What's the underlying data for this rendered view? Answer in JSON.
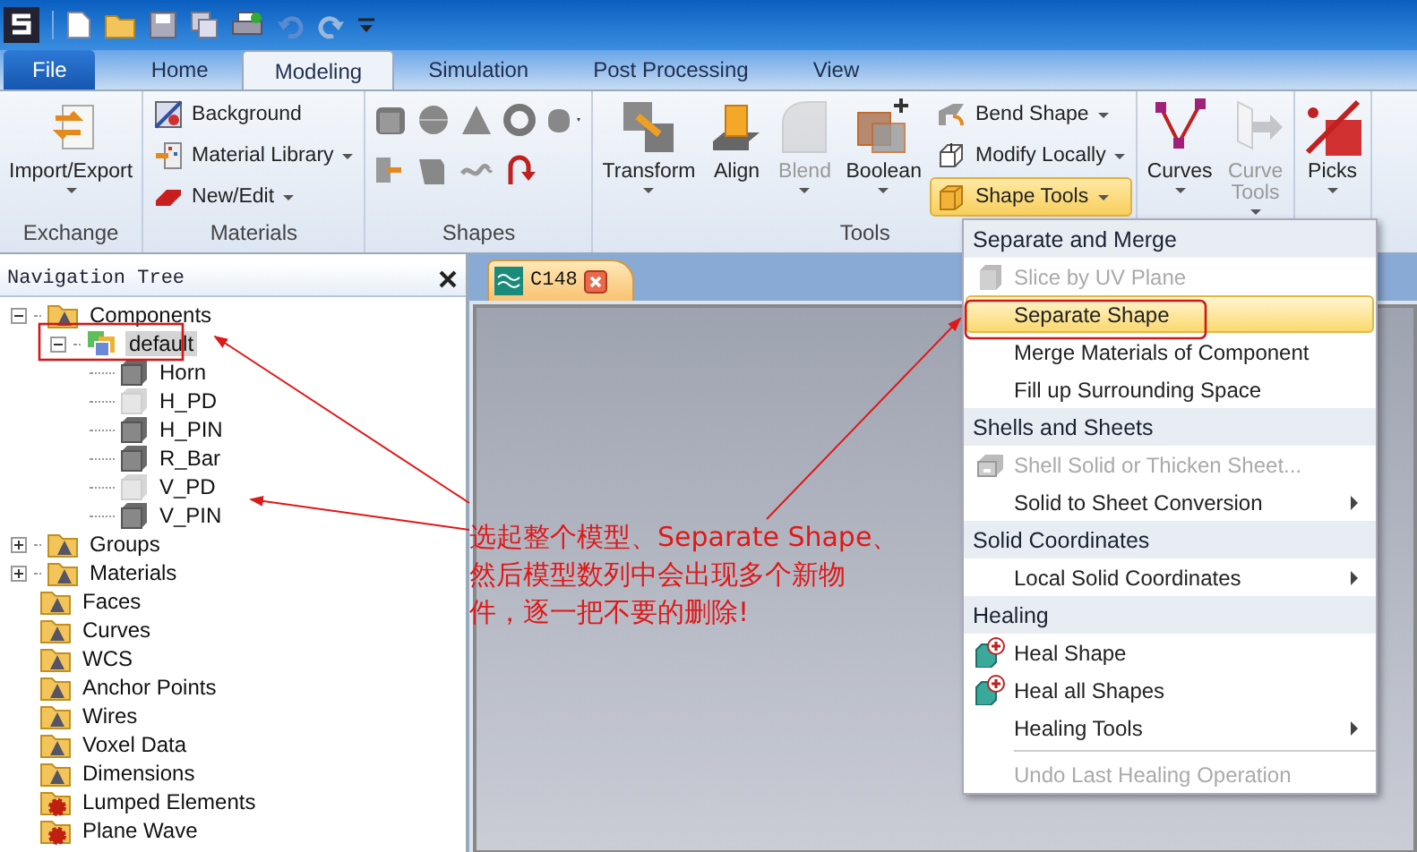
{
  "ribbon_tabs": [
    {
      "label": "File",
      "kind": "file",
      "selected": false
    },
    {
      "label": "Home",
      "kind": "tab",
      "selected": false
    },
    {
      "label": "Modeling",
      "kind": "tab",
      "selected": true
    },
    {
      "label": "Simulation",
      "kind": "tab",
      "selected": false
    },
    {
      "label": "Post Processing",
      "kind": "tab",
      "selected": false
    },
    {
      "label": "View",
      "kind": "tab",
      "selected": false
    }
  ],
  "ribbon_groups": [
    {
      "label": "Exchange",
      "kind": "buttons",
      "items": [
        {
          "label": "Import/Export",
          "kind": "large",
          "dropdown": true,
          "disabled": false,
          "selected": false
        }
      ]
    },
    {
      "label": "Materials",
      "kind": "buttons",
      "items": [
        {
          "label": "Background",
          "kind": "small",
          "dropdown": false,
          "disabled": false,
          "selected": false
        },
        {
          "label": "Material Library",
          "kind": "small",
          "dropdown": true,
          "disabled": false,
          "selected": false
        },
        {
          "label": "New/Edit",
          "kind": "small",
          "dropdown": true,
          "disabled": false,
          "selected": false
        }
      ]
    },
    {
      "label": "Shapes",
      "kind": "shapes"
    },
    {
      "label": "Tools",
      "kind": "buttons",
      "items": [
        {
          "label": "Transform",
          "kind": "large",
          "dropdown": true,
          "disabled": false,
          "selected": false
        },
        {
          "label": "Align",
          "kind": "large",
          "dropdown": false,
          "disabled": false,
          "selected": false
        },
        {
          "label": "Blend",
          "kind": "large",
          "dropdown": true,
          "disabled": true,
          "selected": false
        },
        {
          "label": "Boolean",
          "kind": "large",
          "dropdown": true,
          "disabled": false,
          "selected": false
        },
        {
          "label": "Bend Shape",
          "kind": "small",
          "dropdown": true,
          "disabled": false,
          "selected": false
        },
        {
          "label": "Modify Locally",
          "kind": "small",
          "dropdown": true,
          "disabled": false,
          "selected": false
        },
        {
          "label": "Shape Tools",
          "kind": "small",
          "dropdown": true,
          "disabled": false,
          "selected": true
        }
      ]
    },
    {
      "kind": "buttons",
      "items": [
        {
          "label": "Curves",
          "kind": "large",
          "dropdown": true,
          "disabled": false,
          "selected": false
        },
        {
          "label": "Curve Tools",
          "kind": "large",
          "dropdown": true,
          "disabled": true,
          "selected": false
        }
      ]
    },
    {
      "kind": "buttons",
      "items": [
        {
          "label": "Picks",
          "kind": "large",
          "dropdown": true,
          "disabled": false,
          "selected": false
        }
      ]
    }
  ],
  "navigation_tree": {
    "title": "Navigation Tree",
    "items": [
      {
        "label": "Components",
        "kind": "folder",
        "collapsed": false,
        "selected": false,
        "children": [
          {
            "label": "default",
            "kind": "component",
            "collapsed": false,
            "selected": true,
            "children": [
              {
                "label": "Horn",
                "kind": "solid",
                "hidden": false,
                "selected": false
              },
              {
                "label": "H_PD",
                "kind": "solid",
                "hidden": true,
                "selected": false
              },
              {
                "label": "H_PIN",
                "kind": "solid",
                "hidden": false,
                "selected": false
              },
              {
                "label": "R_Bar",
                "kind": "solid",
                "hidden": false,
                "selected": false
              },
              {
                "label": "V_PD",
                "kind": "solid",
                "hidden": true,
                "selected": false
              },
              {
                "label": "V_PIN",
                "kind": "solid",
                "hidden": false,
                "selected": false
              }
            ]
          }
        ]
      },
      {
        "label": "Groups",
        "kind": "folder",
        "collapsed": true,
        "selected": false
      },
      {
        "label": "Materials",
        "kind": "folder",
        "collapsed": true,
        "selected": false
      },
      {
        "label": "Faces",
        "kind": "folder",
        "collapsed": false,
        "selected": false
      },
      {
        "label": "Curves",
        "kind": "folder",
        "collapsed": false,
        "selected": false
      },
      {
        "label": "WCS",
        "kind": "folder",
        "collapsed": false,
        "selected": false
      },
      {
        "label": "Anchor Points",
        "kind": "folder",
        "collapsed": false,
        "selected": false
      },
      {
        "label": "Wires",
        "kind": "folder",
        "collapsed": false,
        "selected": false
      },
      {
        "label": "Voxel Data",
        "kind": "folder",
        "collapsed": false,
        "selected": false
      },
      {
        "label": "Dimensions",
        "kind": "folder",
        "collapsed": false,
        "selected": false
      },
      {
        "label": "Lumped Elements",
        "kind": "source-folder",
        "collapsed": false,
        "selected": false
      },
      {
        "label": "Plane Wave",
        "kind": "source-folder",
        "collapsed": false,
        "selected": false
      }
    ]
  },
  "document_tabs": [
    {
      "label": "C148",
      "selected": true
    }
  ],
  "shape_tools_menu": [
    {
      "heading": "Separate and Merge",
      "items": [
        {
          "label": "Slice by UV Plane",
          "kind": "block",
          "disabled": true,
          "highlighted": false,
          "submenu": false
        },
        {
          "label": "Separate Shape",
          "kind": "plain",
          "disabled": false,
          "highlighted": true,
          "submenu": false
        },
        {
          "label": "Merge Materials of Component",
          "kind": "plain",
          "disabled": false,
          "highlighted": false,
          "submenu": false
        },
        {
          "label": "Fill up Surrounding Space",
          "kind": "plain",
          "disabled": false,
          "highlighted": false,
          "submenu": false
        }
      ]
    },
    {
      "heading": "Shells and Sheets",
      "items": [
        {
          "label": "Shell Solid or Thicken Sheet...",
          "kind": "shell",
          "disabled": true,
          "highlighted": false,
          "submenu": false
        },
        {
          "label": "Solid to Sheet Conversion",
          "kind": "plain",
          "disabled": false,
          "highlighted": false,
          "submenu": true
        }
      ]
    },
    {
      "heading": "Solid Coordinates",
      "items": [
        {
          "label": "Local Solid Coordinates",
          "kind": "plain",
          "disabled": false,
          "highlighted": false,
          "submenu": true
        }
      ]
    },
    {
      "heading": "Healing",
      "items": [
        {
          "label": "Heal Shape",
          "kind": "heal",
          "disabled": false,
          "highlighted": false,
          "submenu": false
        },
        {
          "label": "Heal all Shapes",
          "kind": "heal",
          "disabled": false,
          "highlighted": false,
          "submenu": false
        },
        {
          "label": "Healing Tools",
          "kind": "plain",
          "disabled": false,
          "highlighted": false,
          "submenu": true
        }
      ]
    },
    {
      "items": [
        {
          "label": "Undo Last Healing Operation",
          "kind": "plain",
          "disabled": true,
          "highlighted": false,
          "submenu": false
        }
      ]
    }
  ],
  "annotation": {
    "lines": [
      "选起整个模型、Separate Shape、",
      "然后模型数列中会出现多个新物",
      "件，逐一把不要的删除!"
    ]
  }
}
